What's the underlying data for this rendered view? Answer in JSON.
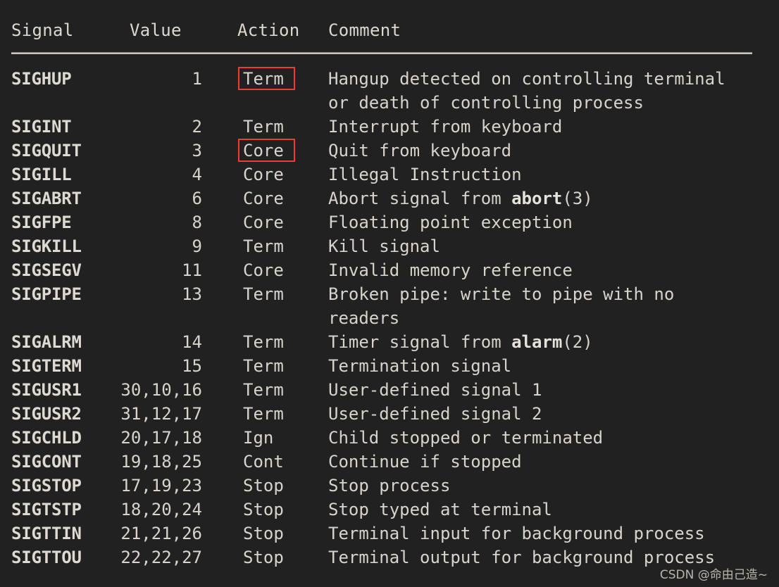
{
  "table": {
    "columns": [
      {
        "key": "signal",
        "label": "Signal"
      },
      {
        "key": "value",
        "label": "Value"
      },
      {
        "key": "action",
        "label": "Action"
      },
      {
        "key": "comment",
        "label": "Comment"
      }
    ],
    "rows": [
      {
        "signal": "SIGHUP",
        "value": "1",
        "action": "Term",
        "comment": "Hangup detected on controlling terminal",
        "comment_cont": "or death of controlling process",
        "highlight": "red-box"
      },
      {
        "signal": "SIGINT",
        "value": "2",
        "action": "Term",
        "comment": "Interrupt from keyboard"
      },
      {
        "signal": "SIGQUIT",
        "value": "3",
        "action": "Core",
        "comment": "Quit from keyboard",
        "highlight": "red-box"
      },
      {
        "signal": "SIGILL",
        "value": "4",
        "action": "Core",
        "comment": "Illegal Instruction"
      },
      {
        "signal": "SIGABRT",
        "value": "6",
        "action": "Core",
        "comment": "Abort signal from abort(3)",
        "comment_bold": "abort"
      },
      {
        "signal": "SIGFPE",
        "value": "8",
        "action": "Core",
        "comment": "Floating point exception"
      },
      {
        "signal": "SIGKILL",
        "value": "9",
        "action": "Term",
        "comment": "Kill signal"
      },
      {
        "signal": "SIGSEGV",
        "value": "11",
        "action": "Core",
        "comment": "Invalid memory reference"
      },
      {
        "signal": "SIGPIPE",
        "value": "13",
        "action": "Term",
        "comment": "Broken pipe: write to pipe with no",
        "comment_cont": "readers"
      },
      {
        "signal": "SIGALRM",
        "value": "14",
        "action": "Term",
        "comment": "Timer signal from alarm(2)",
        "comment_bold": "alarm"
      },
      {
        "signal": "SIGTERM",
        "value": "15",
        "action": "Term",
        "comment": "Termination signal"
      },
      {
        "signal": "SIGUSR1",
        "value": "30,10,16",
        "action": "Term",
        "comment": "User-defined signal 1"
      },
      {
        "signal": "SIGUSR2",
        "value": "31,12,17",
        "action": "Term",
        "comment": "User-defined signal 2"
      },
      {
        "signal": "SIGCHLD",
        "value": "20,17,18",
        "action": "Ign",
        "comment": "Child stopped or terminated"
      },
      {
        "signal": "SIGCONT",
        "value": "19,18,25",
        "action": "Cont",
        "comment": "Continue if stopped"
      },
      {
        "signal": "SIGSTOP",
        "value": "17,19,23",
        "action": "Stop",
        "comment": "Stop process"
      },
      {
        "signal": "SIGTSTP",
        "value": "18,20,24",
        "action": "Stop",
        "comment": "Stop typed at terminal"
      },
      {
        "signal": "SIGTTIN",
        "value": "21,21,26",
        "action": "Stop",
        "comment": "Terminal input for background process"
      },
      {
        "signal": "SIGTTOU",
        "value": "22,22,27",
        "action": "Stop",
        "comment": "Terminal output for background process"
      }
    ]
  },
  "highlights": [
    {
      "target": "SIGHUP",
      "field": "action",
      "text": "Term",
      "color": "#f03c2e"
    },
    {
      "target": "SIGQUIT",
      "field": "action",
      "text": "Core",
      "color": "#f03c2e"
    }
  ],
  "watermark": {
    "text": "CSDN @命由己造~"
  },
  "colors": {
    "background": "#212121",
    "text": "#d8d4cc",
    "heading": "#dcd8d0",
    "divider": "#c8c4bc",
    "highlight": "#f03c2e"
  }
}
